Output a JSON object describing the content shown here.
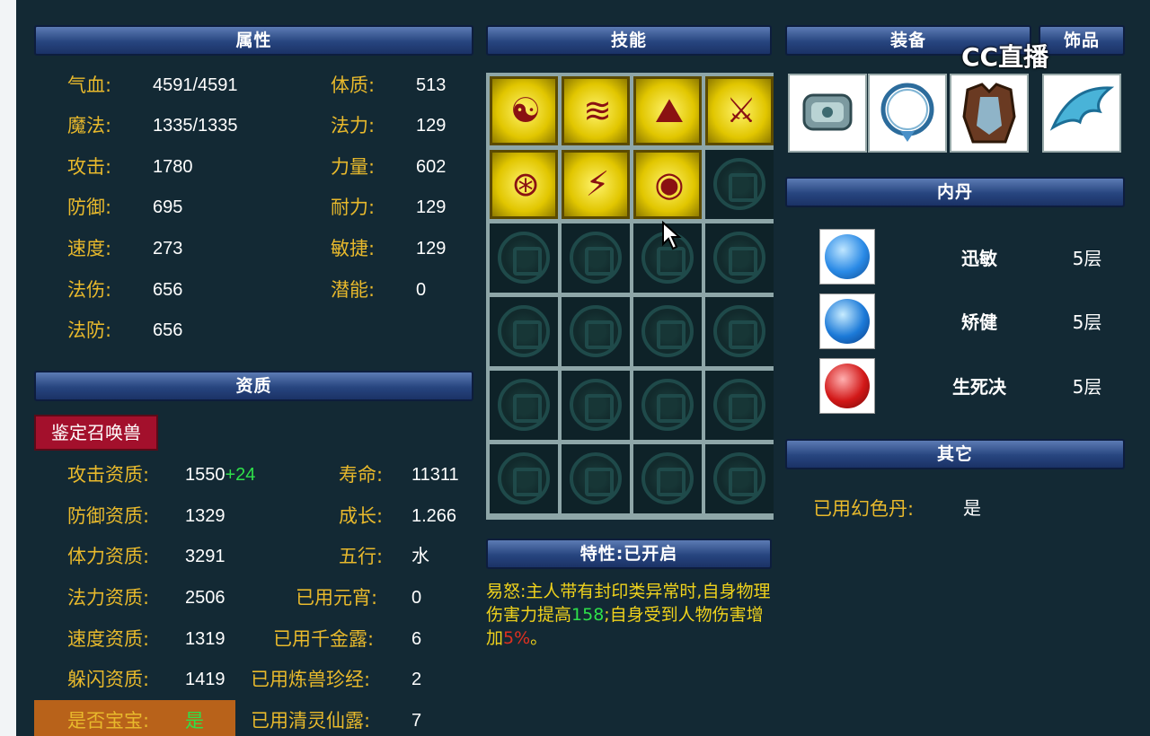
{
  "panels": {
    "attributes": "属性",
    "skills": "技能",
    "equipment": "装备",
    "accessory": "饰品",
    "aptitude": "资质",
    "inner_core": "内丹",
    "trait": "特性:已开启",
    "other": "其它"
  },
  "attributes_left": [
    {
      "label": "气血:",
      "value": "4591/4591"
    },
    {
      "label": "魔法:",
      "value": "1335/1335"
    },
    {
      "label": "攻击:",
      "value": "1780"
    },
    {
      "label": "防御:",
      "value": "695"
    },
    {
      "label": "速度:",
      "value": "273"
    },
    {
      "label": "法伤:",
      "value": "656"
    },
    {
      "label": "法防:",
      "value": "656"
    }
  ],
  "attributes_right": [
    {
      "label": "体质:",
      "value": "513"
    },
    {
      "label": "法力:",
      "value": "129"
    },
    {
      "label": "力量:",
      "value": "602"
    },
    {
      "label": "耐力:",
      "value": "129"
    },
    {
      "label": "敏捷:",
      "value": "129"
    },
    {
      "label": "潜能:",
      "value": "0"
    }
  ],
  "identify_button": "鉴定召唤兽",
  "aptitude_left": [
    {
      "label": "攻击资质:",
      "value": "1550",
      "bonus": "+24"
    },
    {
      "label": "防御资质:",
      "value": "1329",
      "bonus": ""
    },
    {
      "label": "体力资质:",
      "value": "3291",
      "bonus": ""
    },
    {
      "label": "法力资质:",
      "value": "2506",
      "bonus": ""
    },
    {
      "label": "速度资质:",
      "value": "1319",
      "bonus": ""
    },
    {
      "label": "躲闪资质:",
      "value": "1419",
      "bonus": ""
    }
  ],
  "is_baby": {
    "label": "是否宝宝:",
    "value": "是"
  },
  "aptitude_right": [
    {
      "label": "寿命:",
      "value": "11311"
    },
    {
      "label": "成长:",
      "value": "1.266"
    },
    {
      "label": "五行:",
      "value": "水"
    },
    {
      "label": "已用元宵:",
      "value": "0"
    },
    {
      "label": "已用千金露:",
      "value": "6"
    },
    {
      "label": "已用炼兽珍经:",
      "value": "2"
    },
    {
      "label": "已用清灵仙露:",
      "value": "7"
    }
  ],
  "skills": {
    "learned": [
      "skill-monk-icon",
      "skill-wind-arc-icon",
      "skill-landscape-icon",
      "skill-sword-icon",
      "skill-seal-icon",
      "skill-slash-icon",
      "skill-eye-icon"
    ],
    "total_slots": 24,
    "empty_slot_icon": "empty-slot-knot-icon"
  },
  "trait": {
    "name": "易怒",
    "text_a": ":主人带有封印类异常时,自身物理伤害力提高",
    "value_a": "158",
    "text_b": ";自身受到人物伤害增加",
    "value_b": "5%",
    "text_c": "。"
  },
  "equipment": [
    "bracer-icon",
    "necklace-icon",
    "armor-icon",
    "wing-accessory-icon"
  ],
  "inner_cores": [
    {
      "name": "迅敏",
      "level": "5层",
      "icon": "claw-orb-icon",
      "color": "#2a8ae6"
    },
    {
      "name": "矫健",
      "level": "5层",
      "icon": "drop-orb-icon",
      "color": "#1c7ad8"
    },
    {
      "name": "生死决",
      "level": "5层",
      "icon": "beast-orb-icon",
      "color": "#d21818"
    }
  ],
  "other": {
    "label": "已用幻色丹:",
    "value": "是"
  },
  "watermark": "CC直播",
  "colors": {
    "label": "#e8b92c",
    "header": "#27457f",
    "bg": "#132934",
    "green": "#2fe04a"
  }
}
